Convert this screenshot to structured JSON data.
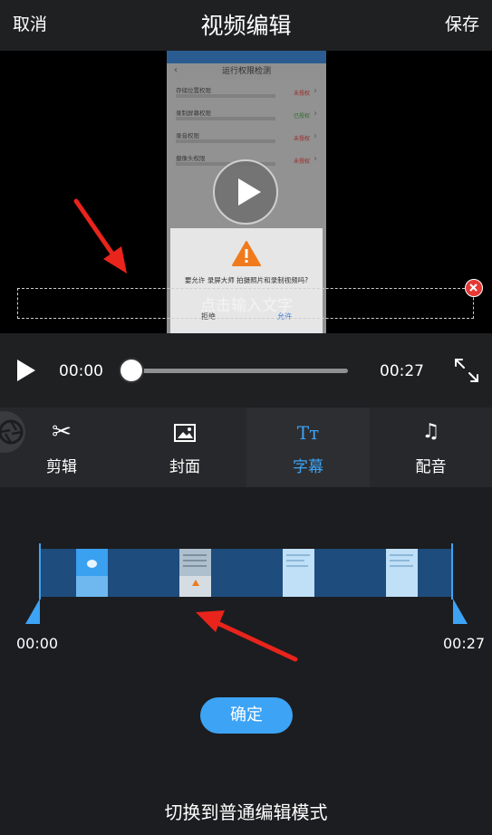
{
  "header": {
    "cancel": "取消",
    "title": "视频编辑",
    "save": "保存"
  },
  "preview": {
    "phone_title": "运行权限检测",
    "rows": [
      {
        "title": "存储位置权限",
        "status": "未授权",
        "color": "#e53935"
      },
      {
        "title": "录制屏幕权限",
        "status": "已授权",
        "color": "#43a047"
      },
      {
        "title": "录音权限",
        "status": "未授权",
        "color": "#e53935"
      },
      {
        "title": "摄像头权限",
        "status": "未授权",
        "color": "#e53935"
      }
    ],
    "dialog_message": "要允许 录屏大师 拍摄照片和录制视频吗?",
    "dialog_deny": "拒绝",
    "dialog_allow": "允许",
    "text_placeholder": "点击输入文字"
  },
  "player": {
    "current_time": "00:00",
    "total_time": "00:27",
    "progress": 0
  },
  "tabs": [
    {
      "label": "剪辑",
      "icon": "scissors-icon",
      "glyph": "✂"
    },
    {
      "label": "封面",
      "icon": "image-icon",
      "glyph": ""
    },
    {
      "label": "字幕",
      "icon": "text-icon",
      "glyph": "Tт"
    },
    {
      "label": "配音",
      "icon": "music-icon",
      "glyph": "♫"
    }
  ],
  "active_tab": 2,
  "timeline": {
    "start": "00:00",
    "end": "00:27"
  },
  "confirm_label": "确定",
  "switch_mode_label": "切换到普通编辑模式",
  "colors": {
    "accent": "#3da3f5",
    "annotation_arrow": "#e8241c"
  }
}
